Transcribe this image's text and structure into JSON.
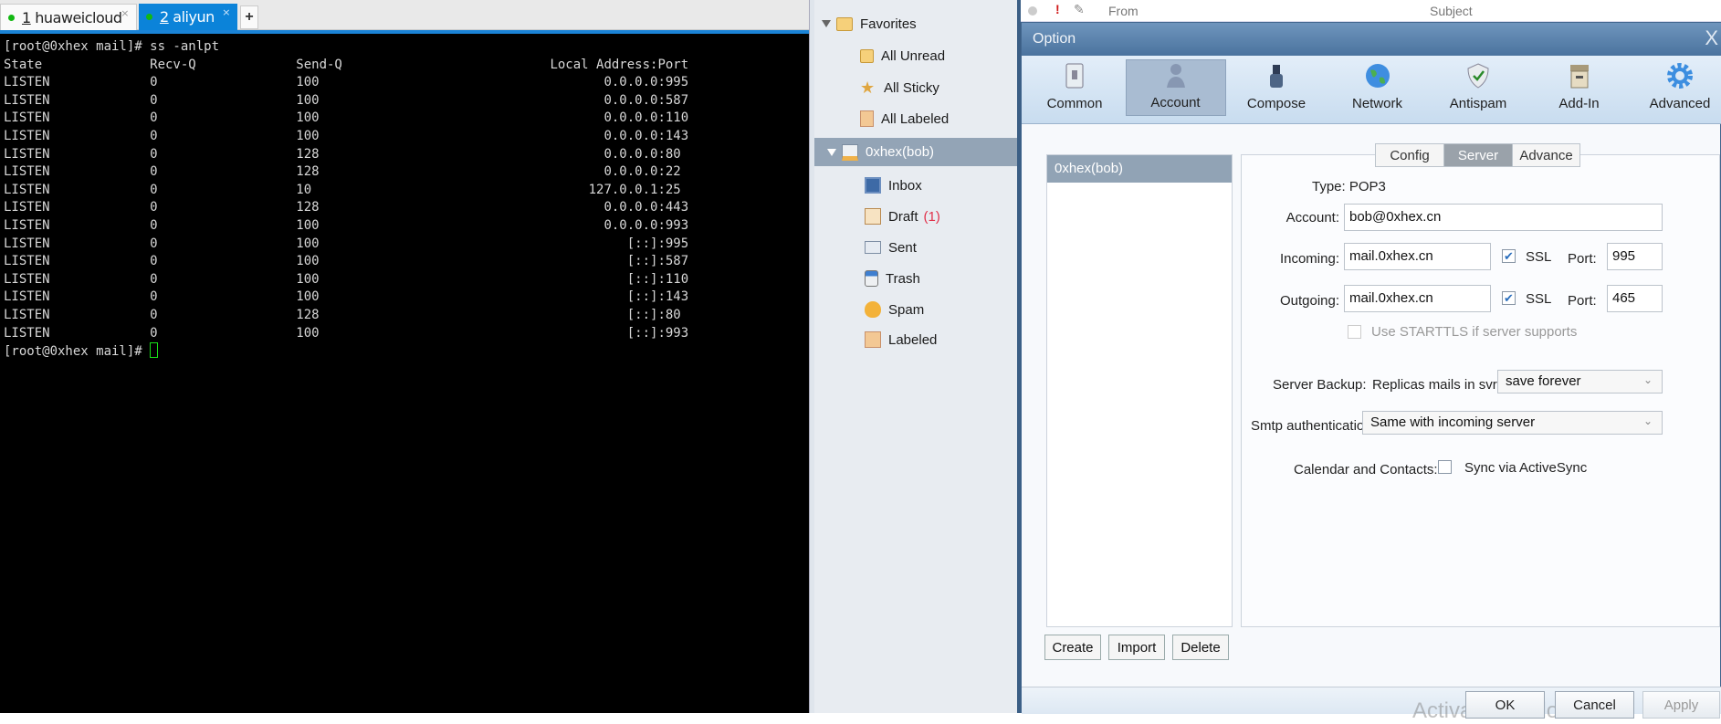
{
  "terminal": {
    "tabs": [
      {
        "num": "1",
        "label": "huaweicloud"
      },
      {
        "num": "2",
        "label": "aliyun"
      }
    ],
    "new_tab": "+",
    "prompt": "[root@0xhex mail]# ",
    "command": "ss -anlpt",
    "headers": [
      "State",
      "Recv-Q",
      "Send-Q",
      "Local Address:Port"
    ],
    "rows": [
      [
        "LISTEN",
        "0",
        "100",
        "0.0.0.0",
        "995"
      ],
      [
        "LISTEN",
        "0",
        "100",
        "0.0.0.0",
        "587"
      ],
      [
        "LISTEN",
        "0",
        "100",
        "0.0.0.0",
        "110"
      ],
      [
        "LISTEN",
        "0",
        "100",
        "0.0.0.0",
        "143"
      ],
      [
        "LISTEN",
        "0",
        "128",
        "0.0.0.0",
        "80"
      ],
      [
        "LISTEN",
        "0",
        "128",
        "0.0.0.0",
        "22"
      ],
      [
        "LISTEN",
        "0",
        "10",
        "127.0.0.1",
        "25"
      ],
      [
        "LISTEN",
        "0",
        "128",
        "0.0.0.0",
        "443"
      ],
      [
        "LISTEN",
        "0",
        "100",
        "0.0.0.0",
        "993"
      ],
      [
        "LISTEN",
        "0",
        "100",
        "[::]",
        "995"
      ],
      [
        "LISTEN",
        "0",
        "100",
        "[::]",
        "587"
      ],
      [
        "LISTEN",
        "0",
        "100",
        "[::]",
        "110"
      ],
      [
        "LISTEN",
        "0",
        "100",
        "[::]",
        "143"
      ],
      [
        "LISTEN",
        "0",
        "128",
        "[::]",
        "80"
      ],
      [
        "LISTEN",
        "0",
        "100",
        "[::]",
        "993"
      ]
    ]
  },
  "mail": {
    "favorites": "Favorites",
    "fav_items": [
      "All Unread",
      "All Sticky",
      "All Labeled"
    ],
    "account": "0xhex(bob)",
    "folders": [
      "Inbox",
      "Draft",
      "Sent",
      "Trash",
      "Spam",
      "Labeled"
    ],
    "draft_count": "(1)",
    "list_headers": {
      "from": "From",
      "subject": "Subject"
    }
  },
  "dialog": {
    "title": "Option",
    "close": "X",
    "toolbar": [
      "Common",
      "Account",
      "Compose",
      "Network",
      "Antispam",
      "Add-In",
      "Advanced"
    ],
    "accounts": [
      "0xhex(bob)"
    ],
    "subtabs": [
      "Config",
      "Server",
      "Advance"
    ],
    "type_label": "Type:",
    "type_value": "POP3",
    "account_label": "Account:",
    "account_value": "bob@0xhex.cn",
    "incoming_label": "Incoming:",
    "incoming_value": "mail.0xhex.cn",
    "outgoing_label": "Outgoing:",
    "outgoing_value": "mail.0xhex.cn",
    "ssl_label": "SSL",
    "port_label": "Port:",
    "incoming_port": "995",
    "outgoing_port": "465",
    "starttls_label": "Use STARTTLS if server supports",
    "backup_label": "Server Backup:",
    "replicas_label": "Replicas mails in svr",
    "backup_value": "save forever",
    "smtp_label": "Smtp authentication:",
    "smtp_value": "Same with incoming server",
    "calendar_label": "Calendar and Contacts:",
    "sync_label": "Sync via ActiveSync",
    "buttons": {
      "create": "Create",
      "import": "Import",
      "delete": "Delete",
      "ok": "OK",
      "cancel": "Cancel",
      "apply": "Apply"
    },
    "watermark": "Activate Windows"
  }
}
